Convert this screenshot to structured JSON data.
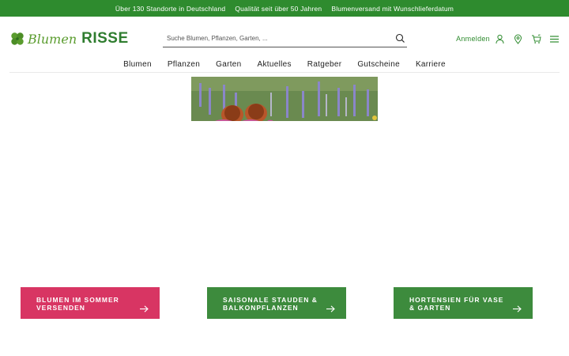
{
  "topbar": {
    "items": [
      "Über 130 Standorte in Deutschland",
      "Qualität seit über 50 Jahren",
      "Blumenversand mit Wunschlieferdatum"
    ]
  },
  "logo": {
    "script_text": "Blumen",
    "bold_text": "RISSE"
  },
  "search": {
    "placeholder": "Suche Blumen, Pflanzen, Garten, ..."
  },
  "header": {
    "login_label": "Anmelden"
  },
  "icons": {
    "search": "search-icon",
    "user": "user-icon",
    "location": "location-pin-icon",
    "cart": "shopping-cart-icon",
    "menu": "menu-icon"
  },
  "nav": {
    "items": [
      "Blumen",
      "Pflanzen",
      "Garten",
      "Aktuelles",
      "Ratgeber",
      "Gutscheine",
      "Karriere"
    ]
  },
  "ctas": [
    {
      "label": "Blumen im Sommer versenden",
      "color": "#d83563"
    },
    {
      "label": "Saisonale Stauden & Balkonpflanzen",
      "color": "#3d8b3d"
    },
    {
      "label": "Hortensien für Vase & Garten",
      "color": "#3d8b3d"
    }
  ],
  "colors": {
    "brand_green": "#2e8b2e",
    "accent_pink": "#d83563"
  }
}
